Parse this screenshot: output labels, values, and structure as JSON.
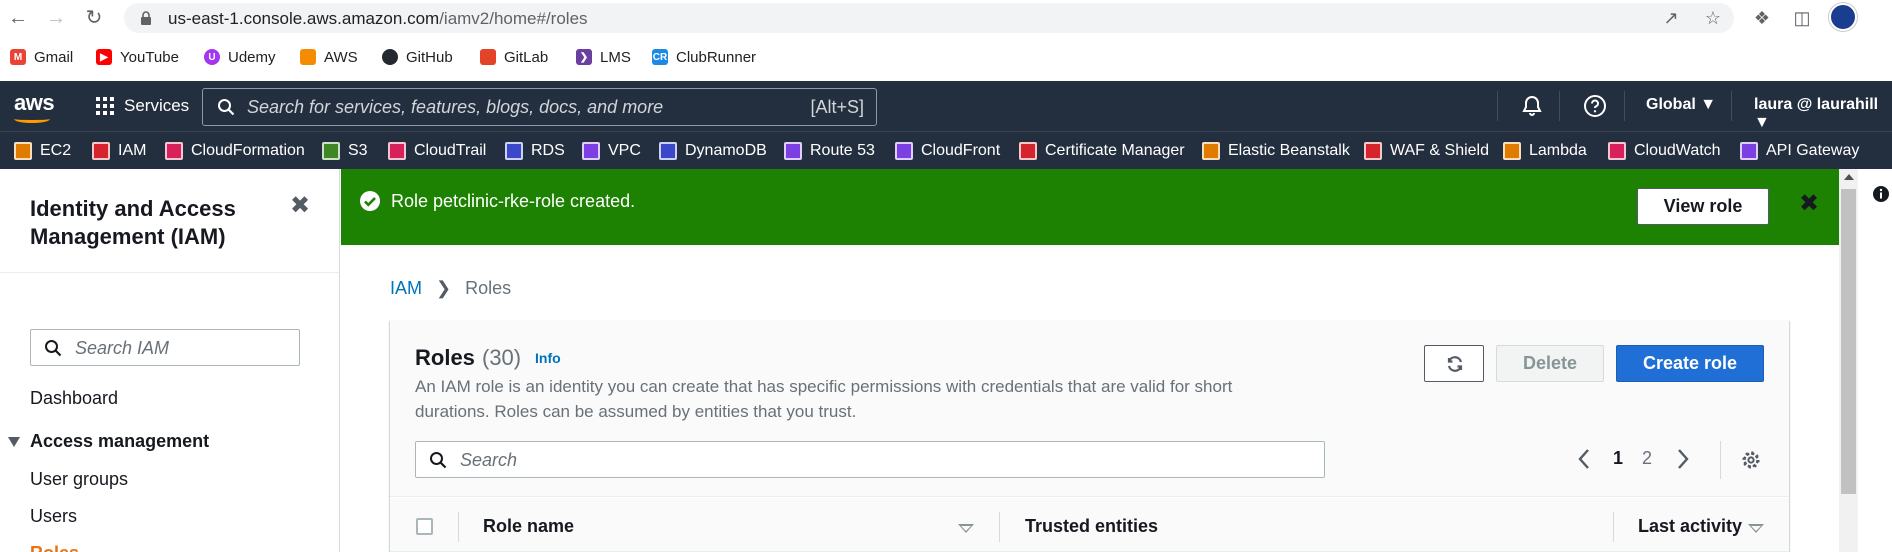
{
  "browser": {
    "url_host": "us-east-1.console.aws.amazon.com",
    "url_path": "/iamv2/home#/roles",
    "bookmarks": [
      {
        "label": "Gmail",
        "icon": "gmail-icon",
        "color": "#ea4335"
      },
      {
        "label": "YouTube",
        "icon": "youtube-icon",
        "color": "#ff0000"
      },
      {
        "label": "Udemy",
        "icon": "udemy-icon",
        "color": "#a435f0"
      },
      {
        "label": "AWS",
        "icon": "aws-cube-icon",
        "color": "#f48b00"
      },
      {
        "label": "GitHub",
        "icon": "github-icon",
        "color": "#24292f"
      },
      {
        "label": "GitLab",
        "icon": "gitlab-icon",
        "color": "#e24329"
      },
      {
        "label": "LMS",
        "icon": "lms-icon",
        "color": "#6b3fa0"
      },
      {
        "label": "ClubRunner",
        "icon": "clubrunner-icon",
        "color": "#1e88e5"
      }
    ]
  },
  "aws_nav": {
    "logo": "aws",
    "services_label": "Services",
    "search_placeholder": "Search for services, features, blogs, docs, and more",
    "search_shortcut": "[Alt+S]",
    "region": "Global",
    "user": "laura @ laurahill",
    "favorites": [
      {
        "label": "EC2",
        "color": "#e07b00"
      },
      {
        "label": "IAM",
        "color": "#d6242d"
      },
      {
        "label": "CloudFormation",
        "color": "#d8215a"
      },
      {
        "label": "S3",
        "color": "#3f8624"
      },
      {
        "label": "CloudTrail",
        "color": "#d8215a"
      },
      {
        "label": "RDS",
        "color": "#3b48cc"
      },
      {
        "label": "VPC",
        "color": "#7b3fe4"
      },
      {
        "label": "DynamoDB",
        "color": "#3b48cc"
      },
      {
        "label": "Route 53",
        "color": "#7b3fe4"
      },
      {
        "label": "CloudFront",
        "color": "#7b3fe4"
      },
      {
        "label": "Certificate Manager",
        "color": "#d6242d"
      },
      {
        "label": "Elastic Beanstalk",
        "color": "#e07b00"
      },
      {
        "label": "WAF & Shield",
        "color": "#d6242d"
      },
      {
        "label": "Lambda",
        "color": "#e07b00"
      },
      {
        "label": "CloudWatch",
        "color": "#d8215a"
      },
      {
        "label": "API Gateway",
        "color": "#7b3fe4"
      }
    ]
  },
  "sidebar": {
    "title": "Identity and Access Management (IAM)",
    "search_placeholder": "Search IAM",
    "dashboard": "Dashboard",
    "section": "Access management",
    "items": [
      "User groups",
      "Users",
      "Roles"
    ]
  },
  "flash": {
    "message": "Role petclinic-rke-role created.",
    "action": "View role",
    "color": "#1d8102"
  },
  "breadcrumb": {
    "root": "IAM",
    "current": "Roles"
  },
  "roles": {
    "title": "Roles",
    "count": "(30)",
    "info": "Info",
    "description_line1": "An IAM role is an identity you can create that has specific permissions with credentials that are valid for short",
    "description_line2": "durations. Roles can be assumed by entities that you trust.",
    "delete_label": "Delete",
    "create_label": "Create role",
    "search_placeholder": "Search",
    "pages": [
      "1",
      "2"
    ],
    "current_page": "1",
    "columns": [
      "Role name",
      "Trusted entities",
      "Last activity"
    ]
  }
}
